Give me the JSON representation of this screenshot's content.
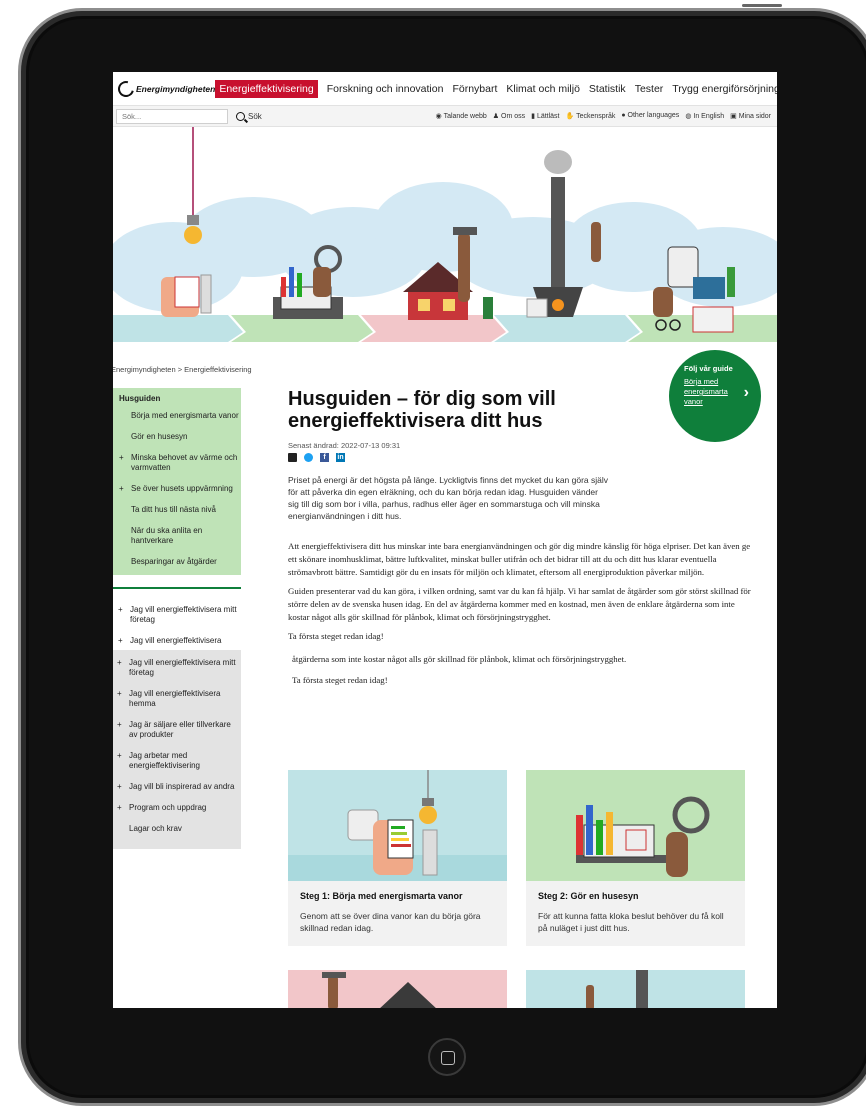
{
  "brand": {
    "logo_text": "Energimyndigheten"
  },
  "nav": {
    "items": [
      {
        "label": "Energieffektivisering",
        "active": true
      },
      {
        "label": "Forskning och innovation"
      },
      {
        "label": "Förnybart"
      },
      {
        "label": "Klimat och miljö"
      },
      {
        "label": "Statistik"
      },
      {
        "label": "Tester"
      },
      {
        "label": "Trygg energiförsörjning"
      }
    ]
  },
  "search": {
    "placeholder": "Sök...",
    "button_label": "Sök"
  },
  "utilities": [
    {
      "icon": "speaker-icon",
      "label": "Talande webb"
    },
    {
      "icon": "person-icon",
      "label": "Om oss"
    },
    {
      "icon": "easy-read-icon",
      "label": "Lättläst"
    },
    {
      "icon": "sign-language-icon",
      "label": "Teckenspråk"
    },
    {
      "icon": "speech-bubble-icon",
      "label": "Other languages"
    },
    {
      "icon": "globe-icon",
      "label": "In English"
    },
    {
      "icon": "lock-icon",
      "label": "Mina sidor"
    }
  ],
  "breadcrumb": "Energimyndigheten > Energieffektivisering",
  "guide_badge": {
    "title": "Följ vår guide",
    "link": "Börja med energismarta vanor"
  },
  "sidebar": {
    "heading": "Husguiden",
    "items": [
      {
        "prefix": "",
        "label": "Börja med energismarta vanor"
      },
      {
        "prefix": "",
        "label": "Gör en husesyn"
      },
      {
        "prefix": "+",
        "label": "Minska behovet av värme och varmvatten"
      },
      {
        "prefix": "+",
        "label": "Se över husets uppvärmning"
      },
      {
        "prefix": "",
        "label": "Ta ditt hus till nästa nivå"
      },
      {
        "prefix": "",
        "label": "När du ska anlita en hantverkare"
      },
      {
        "prefix": "",
        "label": "Besparingar av åtgärder"
      }
    ],
    "outer_items": [
      {
        "prefix": "+",
        "label": "Jag vill energieffektivisera mitt företag"
      },
      {
        "prefix": "+",
        "label": "Jag vill energieffektivisera"
      }
    ],
    "gray_items": [
      {
        "prefix": "+",
        "label": "Jag vill energieffektivisera mitt företag"
      },
      {
        "prefix": "+",
        "label": "Jag vill energieffektivisera hemma"
      },
      {
        "prefix": "+",
        "label": "Jag är säljare eller tillverkare av produkter"
      },
      {
        "prefix": "+",
        "label": "Jag arbetar med energieffektivisering"
      },
      {
        "prefix": "+",
        "label": "Jag vill bli inspirerad av andra"
      },
      {
        "prefix": "+",
        "label": "Program och uppdrag"
      },
      {
        "prefix": "",
        "label": "Lagar och krav"
      }
    ]
  },
  "article": {
    "title": "Husguiden – för dig som vill energieffektivisera ditt hus",
    "updated": "Senast ändrad: 2022-07-13 09:31",
    "lead": "Priset på energi är det högsta på länge. Lyckligtvis finns det mycket du kan göra själv för att påverka din egen elräkning, och du kan börja redan idag. Husguiden vänder sig till dig som bor i villa, parhus, radhus eller äger en sommarstuga och vill minska energianvändningen i ditt hus.",
    "p1": "Att energieffektivisera ditt hus minskar inte bara energianvändningen och gör dig mindre känslig för höga elpriser. Det kan även ge ett skönare inomhusklimat, bättre luftkvalitet, minskat buller utifrån och det bidrar till att du och ditt hus klarar eventuella strömavbrott bättre. Samtidigt gör du en insats för miljön och klimatet, eftersom all energiproduktion påverkar miljön.",
    "p2": "Guiden presenterar vad du kan göra, i vilken ordning, samt var du kan få hjälp. Vi har samlat de åtgärder som gör störst skillnad för större delen av de svenska husen idag. En del av åtgärderna kommer med en kostnad, men även de enklare åtgärderna som inte kostar något alls gör skillnad för plånbok, klimat och försörjningstrygghet.",
    "p3": "Ta första steget redan idag!",
    "p4": "åtgärderna som inte kostar något alls gör skillnad för plånbok, klimat och försörjningstrygghet.",
    "p5": "Ta första steget redan idag!"
  },
  "cards": [
    {
      "title": "Steg 1: Börja med energismarta vanor",
      "text": "Genom att se över dina vanor kan du börja göra skillnad redan idag.",
      "color": "#bfe3e6"
    },
    {
      "title": "Steg 2: Gör en husesyn",
      "text": "För att kunna fatta kloka beslut behöver du få koll på nuläget i just ditt hus.",
      "color": "#bfe3b7"
    }
  ],
  "colors": {
    "brand_red": "#c8102e",
    "green": "#0f7f3b",
    "sidebar_green": "#bfe3b7",
    "sidebar_gray": "#e3e3e3"
  }
}
